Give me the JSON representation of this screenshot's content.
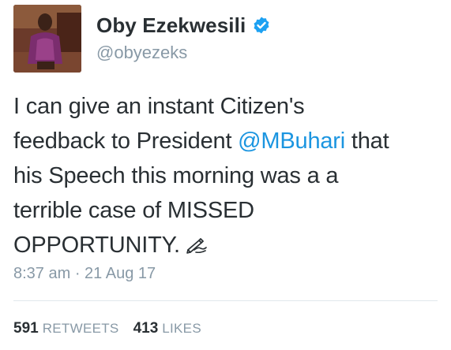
{
  "author": {
    "display_name": "Oby Ezekwesili",
    "handle": "@obyezeks",
    "verified": true
  },
  "tweet": {
    "text_line1": "I can give an instant Citizen's",
    "text_line2_prefix": "feedback to President ",
    "mention": "@MBuhari",
    "text_line2_suffix": " that",
    "text_line3": "his Speech this morning was a a",
    "text_line4": "terrible case of MISSED",
    "text_line5": "OPPORTUNITY.",
    "emoji_icon": "writing-hand-icon",
    "timestamp": "8:37 am · 21 Aug 17"
  },
  "stats": {
    "retweets_count": "591",
    "retweets_label": "RETWEETS",
    "likes_count": "413",
    "likes_label": "LIKES"
  },
  "colors": {
    "mention": "#1b95e0",
    "verified_badge": "#1da1f2",
    "secondary_text": "#8899a6",
    "primary_text": "#292f33"
  }
}
